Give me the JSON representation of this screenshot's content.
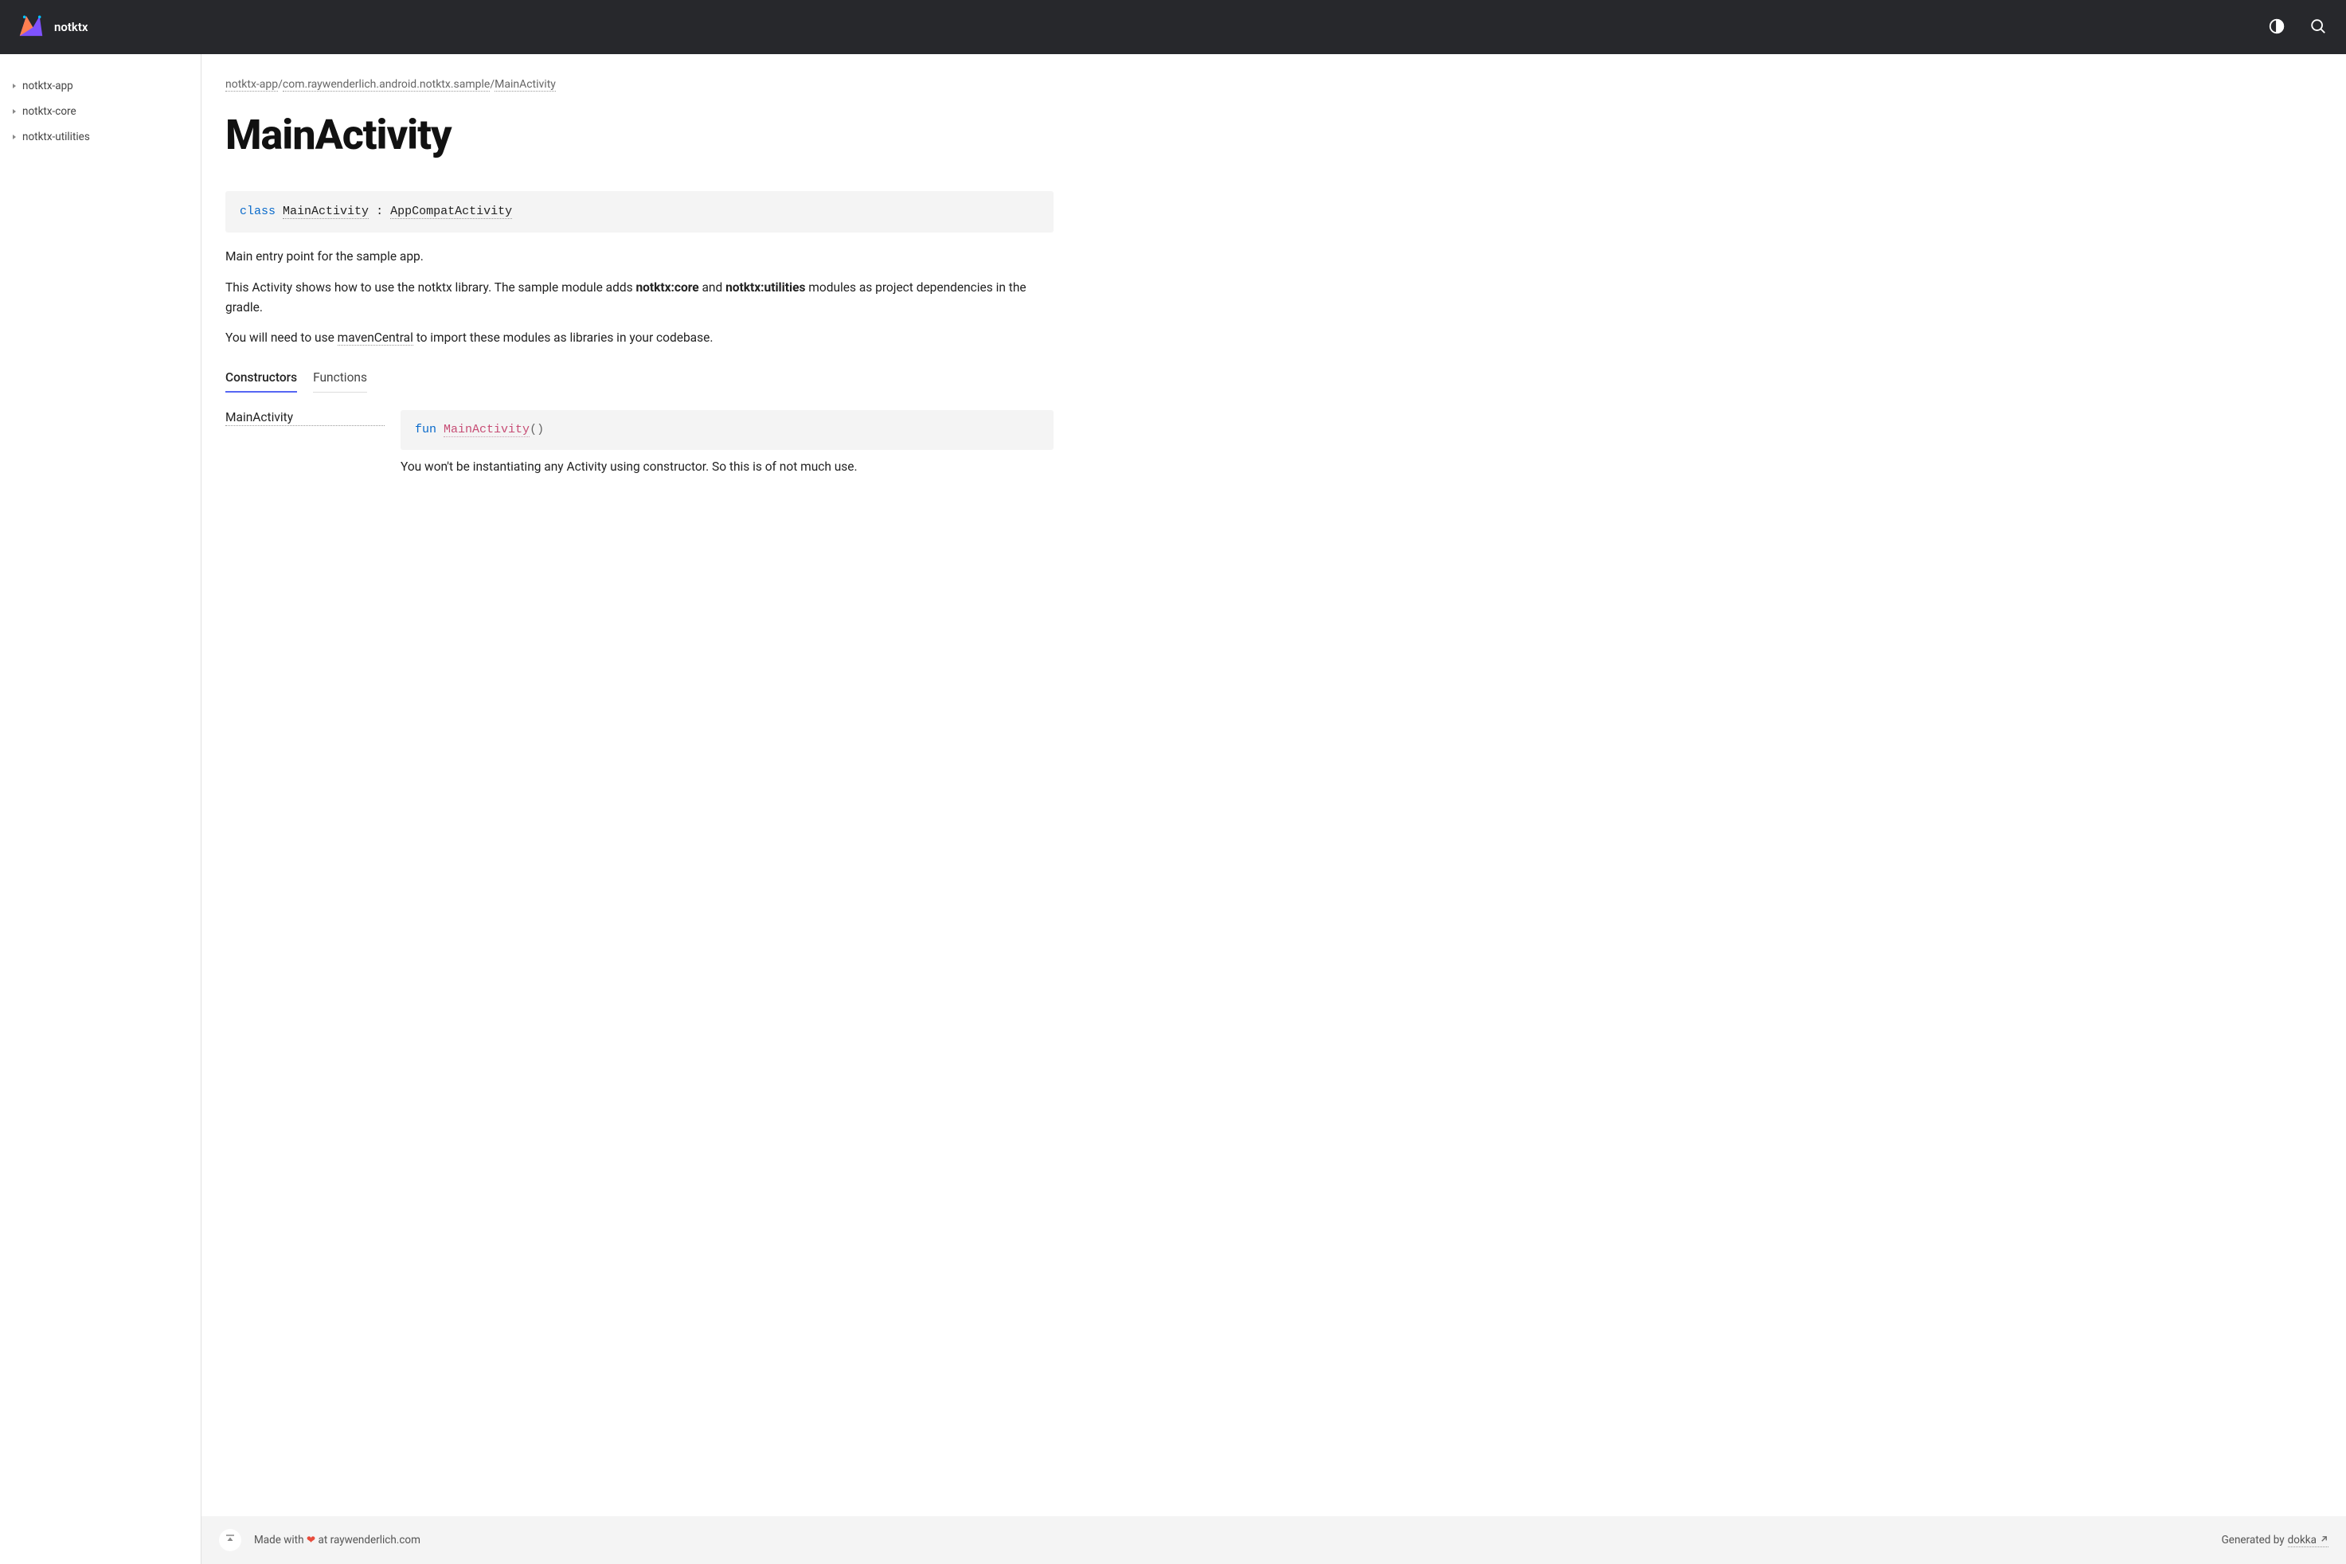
{
  "header": {
    "title": "notktx"
  },
  "sidebar": {
    "items": [
      {
        "label": "notktx-app"
      },
      {
        "label": "notktx-core"
      },
      {
        "label": "notktx-utilities"
      }
    ]
  },
  "breadcrumb": {
    "parts": [
      "notktx-app",
      "com.raywenderlich.android.notktx.sample",
      "MainActivity"
    ]
  },
  "page": {
    "title": "MainActivity"
  },
  "signature": {
    "keyword": "class",
    "name": "MainActivity",
    "separator": " : ",
    "parent": "AppCompatActivity"
  },
  "description": {
    "p1": "Main entry point for the sample app.",
    "p2_pre": "This Activity shows how to use the notktx library. The sample module adds ",
    "p2_strong1": "notktx:core",
    "p2_mid": " and ",
    "p2_strong2": "notktx:utilities",
    "p2_post": " modules as project dependencies in the gradle.",
    "p3_pre": "You will need to use ",
    "p3_link": "mavenCentral",
    "p3_post": " to import these modules as libraries in your codebase."
  },
  "tabs": [
    {
      "label": "Constructors",
      "active": true
    },
    {
      "label": "Functions",
      "active": false
    }
  ],
  "members": {
    "constructor": {
      "name": "MainActivity",
      "sig_keyword": "fun",
      "sig_name": "MainActivity",
      "sig_parens": "()",
      "desc": "You won't be instantiating any Activity using constructor. So this is of not much use."
    }
  },
  "footer": {
    "left_pre": "Made with ",
    "heart": "❤",
    "left_post": " at raywenderlich.com",
    "right_pre": "Generated by ",
    "right_link": "dokka"
  }
}
